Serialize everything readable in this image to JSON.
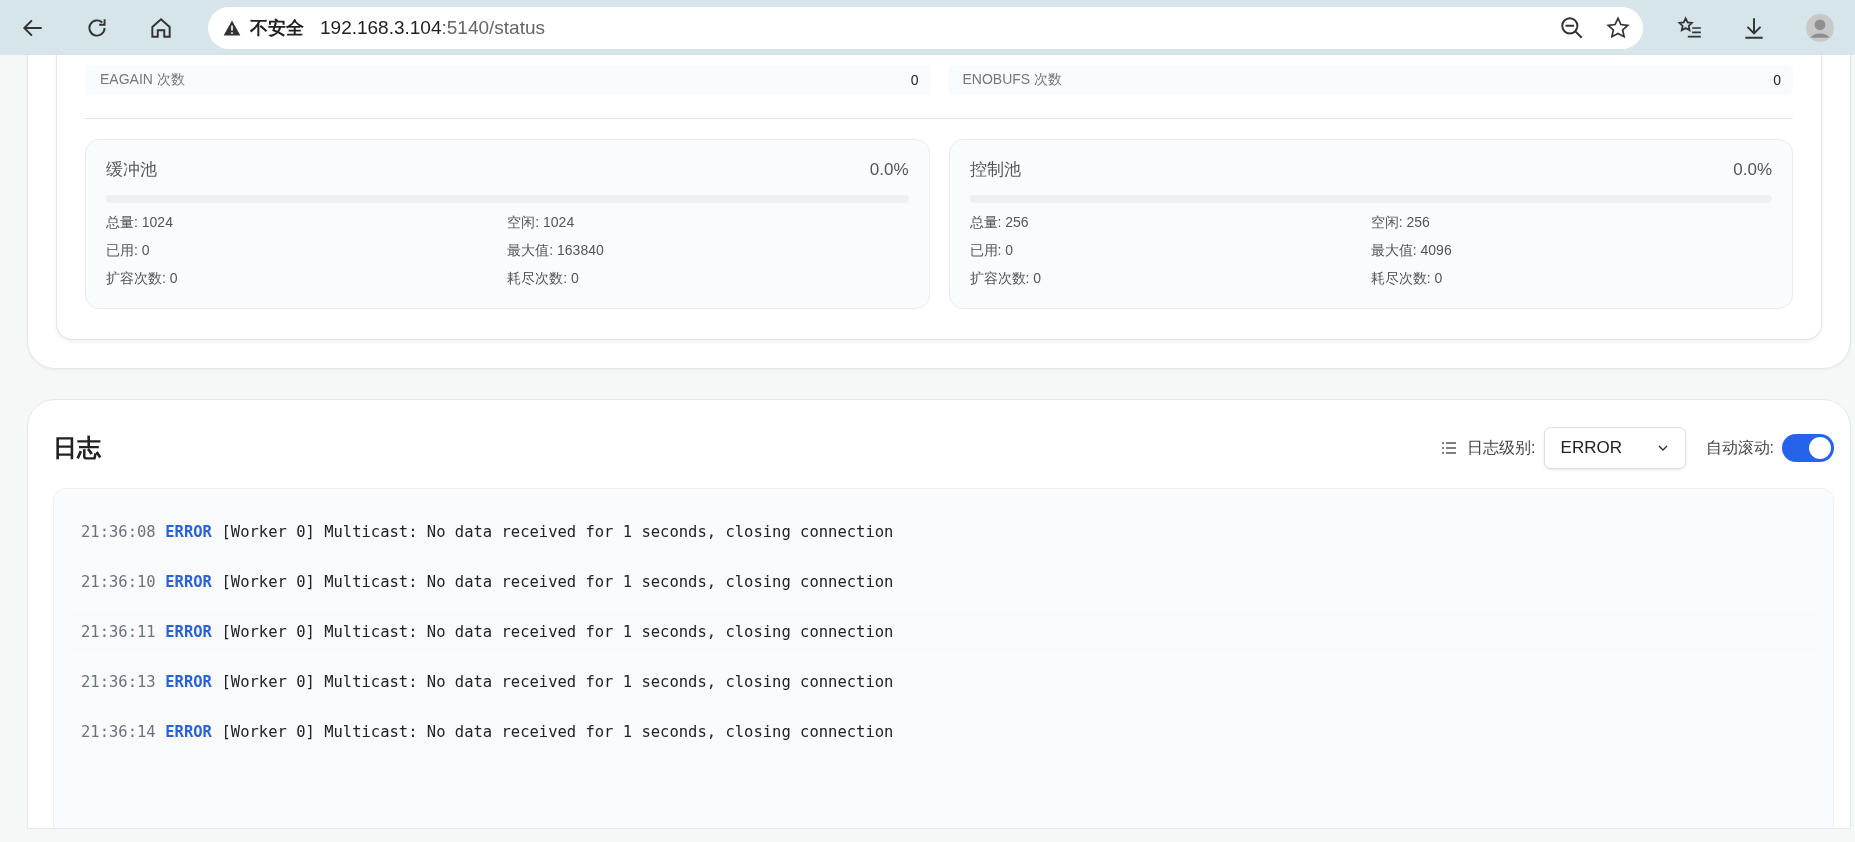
{
  "browser": {
    "security_label": "不安全",
    "url_host": "192.168.3.104",
    "url_path": ":5140/status"
  },
  "counters": [
    {
      "label": "EAGAIN 次数",
      "value": "0"
    },
    {
      "label": "ENOBUFS 次数",
      "value": "0"
    }
  ],
  "pools": [
    {
      "title": "缓冲池",
      "percent": "0.0%",
      "level": 0,
      "stats": [
        "总量: 1024",
        "空闲: 1024",
        "已用: 0",
        "最大值: 163840",
        "扩容次数: 0",
        "耗尽次数: 0"
      ]
    },
    {
      "title": "控制池",
      "percent": "0.0%",
      "level": 0,
      "stats": [
        "总量: 256",
        "空闲: 256",
        "已用: 0",
        "最大值: 4096",
        "扩容次数: 0",
        "耗尽次数: 0"
      ]
    }
  ],
  "log": {
    "title": "日志",
    "level_label": "日志级别:",
    "level_value": "ERROR",
    "autoscroll_label": "自动滚动:",
    "autoscroll_on": true,
    "entries": [
      {
        "time": "21:36:08",
        "kind": "error",
        "level_text": "ERROR",
        "message": "[Worker 0] Multicast: No data received for 1 seconds, closing connection"
      },
      {
        "time": "21:36:10",
        "kind": "error",
        "level_text": "ERROR",
        "message": "[Worker 0] Multicast: No data received for 1 seconds, closing connection"
      },
      {
        "time": "21:36:11",
        "kind": "error",
        "level_text": "ERROR",
        "message": "[Worker 0] Multicast: No data received for 1 seconds, closing connection"
      },
      {
        "time": "21:36:13",
        "kind": "error",
        "level_text": "ERROR",
        "message": "[Worker 0] Multicast: No data received for 1 seconds, closing connection"
      },
      {
        "time": "21:36:14",
        "kind": "error",
        "level_text": "ERROR",
        "message": "[Worker 0] Multicast: No data received for 1 seconds, closing connection"
      }
    ]
  }
}
